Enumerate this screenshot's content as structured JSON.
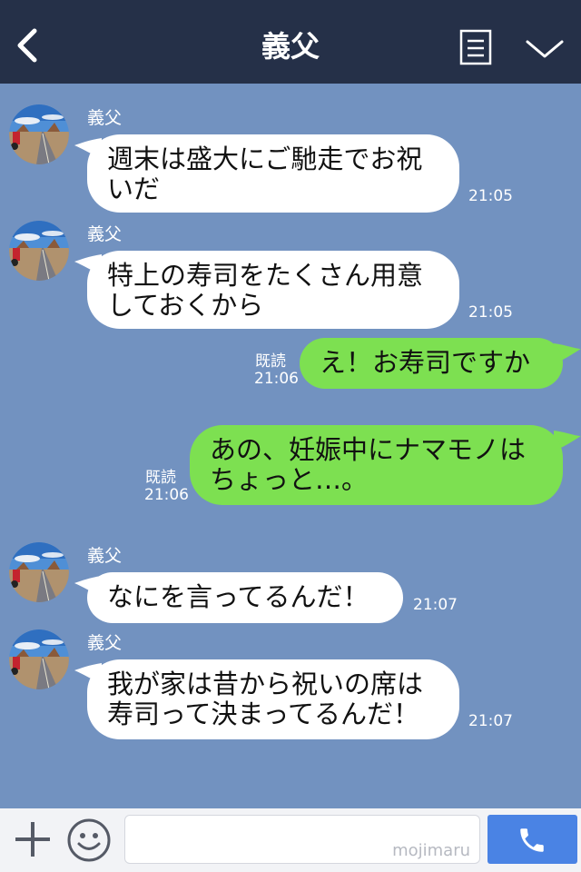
{
  "header": {
    "title": "義父"
  },
  "messages": [
    {
      "sender": "義父",
      "text": "週末は盛大にご馳走でお祝\nいだ",
      "time": "21:05"
    },
    {
      "sender": "義父",
      "text": "特上の寿司をたくさん用意\nしておくから",
      "time": "21:05"
    },
    {
      "text": "え！お寿司ですか",
      "read": "既読",
      "time": "21:06"
    },
    {
      "text": "あの、妊娠中にナマモノは\nちょっと…。",
      "read": "既読",
      "time": "21:06"
    },
    {
      "sender": "義父",
      "text": "なにを言ってるんだ！",
      "time": "21:07"
    },
    {
      "sender": "義父",
      "text": "我が家は昔から祝いの席は\n寿司って決まってるんだ！",
      "time": "21:07"
    }
  ],
  "footer": {
    "watermark": "mojimaru"
  },
  "colors": {
    "header_bg": "#253048",
    "chat_bg": "#7292c0",
    "incoming_bubble": "#ffffff",
    "outgoing_bubble": "#7de051",
    "send_button": "#4a83e4"
  },
  "icons": [
    "back-arrow-icon",
    "notes-icon",
    "chevron-down-icon",
    "plus-icon",
    "emoji-icon",
    "phone-icon"
  ]
}
